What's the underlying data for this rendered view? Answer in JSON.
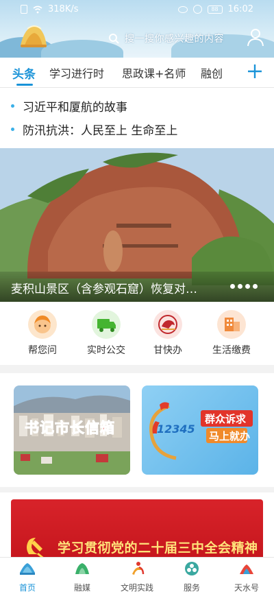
{
  "status_bar": {
    "speed": "318K/s",
    "time": "16:02",
    "battery": "88"
  },
  "search": {
    "placeholder": "搜一搜你感兴趣的内容"
  },
  "tabs": [
    {
      "label": "头条",
      "active": true
    },
    {
      "label": "学习进行时",
      "active": false
    },
    {
      "label": "思政课+名师",
      "active": false
    },
    {
      "label": "融创",
      "active": false
    }
  ],
  "headlines": [
    "习近平和厦航的故事",
    "防汛抗洪：人民至上 生命至上"
  ],
  "banner": {
    "title": "麦积山景区（含参观石窟）恢复对…",
    "dot_count": 4
  },
  "services": [
    {
      "label": "帮您问",
      "icon": "face-icon",
      "color": "#f7a03c"
    },
    {
      "label": "实时公交",
      "icon": "truck-icon",
      "color": "#4cbb3a"
    },
    {
      "label": "甘快办",
      "icon": "horse-icon",
      "color": "#c0282d"
    },
    {
      "label": "生活缴费",
      "icon": "building-icon",
      "color": "#f08a3c"
    }
  ],
  "cards": [
    {
      "title": "书记市长信箱"
    },
    {
      "hotline": "12345",
      "line1": "群众诉求",
      "line2": "马上就办"
    }
  ],
  "promo": {
    "title": "学习贯彻党的二十届三中全会精神"
  },
  "bottom_nav": [
    {
      "label": "首页",
      "icon": "home-icon",
      "active": true
    },
    {
      "label": "融媒",
      "icon": "media-icon",
      "active": false
    },
    {
      "label": "文明实践",
      "icon": "practice-icon",
      "active": false
    },
    {
      "label": "服务",
      "icon": "service-icon",
      "active": false
    },
    {
      "label": "天水号",
      "icon": "tianshui-icon",
      "active": false
    }
  ]
}
